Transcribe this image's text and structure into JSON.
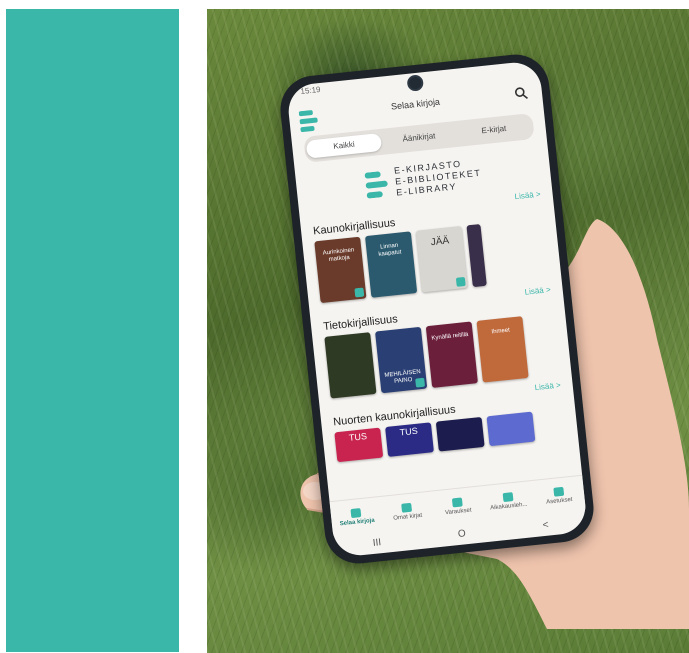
{
  "colors": {
    "teal": "#3bb7aa",
    "grass": "#5d7d3a",
    "phone": "#1d2328",
    "skin": "#efc4ad"
  },
  "status_bar": {
    "time": "15:19"
  },
  "app_bar": {
    "title": "Selaa kirjoja",
    "menu_icon": "menu-icon",
    "search_icon": "search-icon"
  },
  "tabs": [
    {
      "label": "Kaikki",
      "active": true
    },
    {
      "label": "Äänikirjat",
      "active": false
    },
    {
      "label": "E-kirjat",
      "active": false
    }
  ],
  "brand": {
    "line1": "E-KIRJASTO",
    "line2": "E-BIBLIOTEKET",
    "line3": "E-LIBRARY"
  },
  "sections": [
    {
      "more": "Lisää  >",
      "title": "Kaunokirjallisuus",
      "covers": [
        {
          "label": "Aurinkoinen matkoja"
        },
        {
          "label": "Linnan kaapatut"
        },
        {
          "label": "JÄÄ"
        },
        {
          "label": ""
        }
      ]
    },
    {
      "more": "Lisää  >",
      "title": "Tietokirjallisuus",
      "covers": [
        {
          "label": ""
        },
        {
          "label": "MEHILÄISEN PAINO"
        },
        {
          "label": "Kynällä reitillä"
        },
        {
          "label": "Ihmeet"
        }
      ]
    },
    {
      "more": "Lisää  >",
      "title": "Nuorten kaunokirjallisuus",
      "covers": [
        {
          "label": "TUS"
        },
        {
          "label": "TUS"
        },
        {
          "label": ""
        },
        {
          "label": ""
        }
      ]
    }
  ],
  "bottom_nav": [
    {
      "label": "Selaa kirjoja",
      "icon": "books-icon",
      "active": true
    },
    {
      "label": "Omat kirjat",
      "icon": "bookshelf-icon",
      "active": false
    },
    {
      "label": "Varaukset",
      "icon": "bookmark-icon",
      "active": false
    },
    {
      "label": "Aikakausleh...",
      "icon": "magazine-icon",
      "active": false
    },
    {
      "label": "Asetukset",
      "icon": "gear-icon",
      "active": false
    }
  ],
  "system_nav": {
    "recent": "III",
    "home": "O",
    "back": "<"
  }
}
